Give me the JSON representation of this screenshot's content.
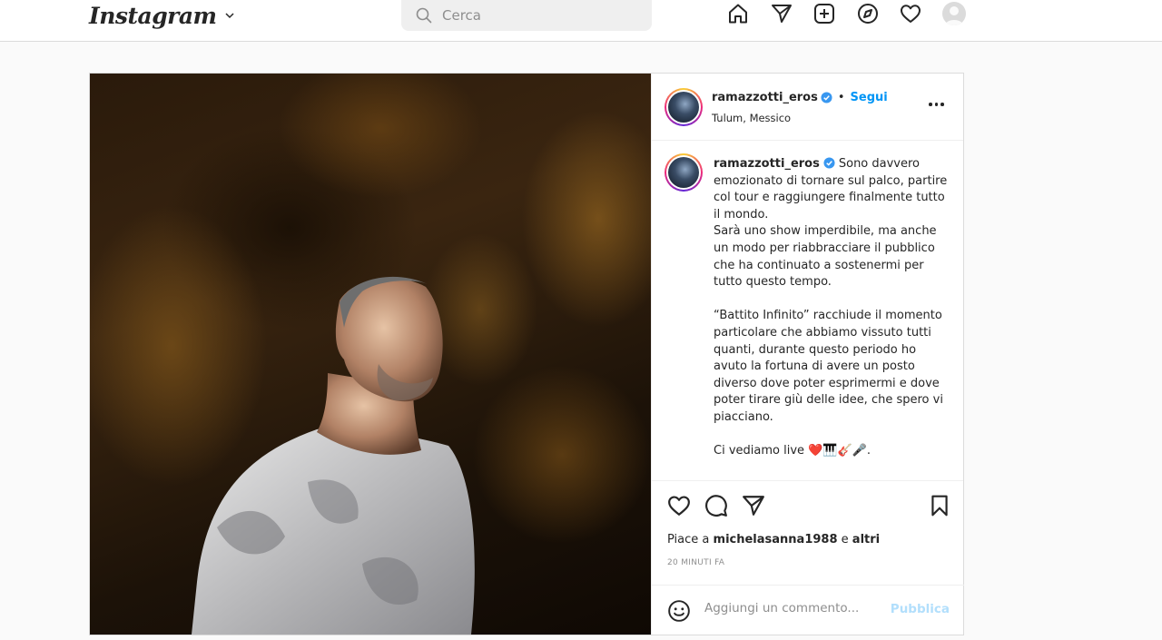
{
  "nav": {
    "logo": "Instagram",
    "search_placeholder": "Cerca",
    "icons": [
      "home-icon",
      "direct-icon",
      "new-post-icon",
      "explore-icon",
      "activity-icon",
      "profile-avatar"
    ]
  },
  "post": {
    "username": "ramazzotti_eros",
    "separator": "•",
    "follow": "Segui",
    "location": "Tulum, Messico",
    "caption": {
      "username": "ramazzotti_eros",
      "text": "Sono davvero emozionato di tornare sul palco, partire col tour e raggiungere finalmente tutto il mondo.\nSarà uno show imperdibile, ma anche un modo per riabbracciare il pubblico che ha continuato a sostenermi per tutto questo tempo.\n\n“Battito Infinito” racchiude il momento particolare che abbiamo vissuto tutti quanti, durante questo periodo ho avuto la fortuna di avere un posto diverso dove poter esprimermi e dove poter tirare giù delle idee, che spero vi piacciano.\n\nCi vediamo live ❤️🎹🎸🎤."
    },
    "likes": {
      "prefix": "Piace a",
      "user": "michelasanna1988",
      "conj": "e",
      "others": "altri"
    },
    "time": "20 MINUTI FA",
    "comment_placeholder": "Aggiungi un commento...",
    "publish": "Pubblica"
  },
  "colors": {
    "accent": "#0095f6",
    "publish_disabled": "#b2dffc",
    "verified": "#3897f0"
  }
}
